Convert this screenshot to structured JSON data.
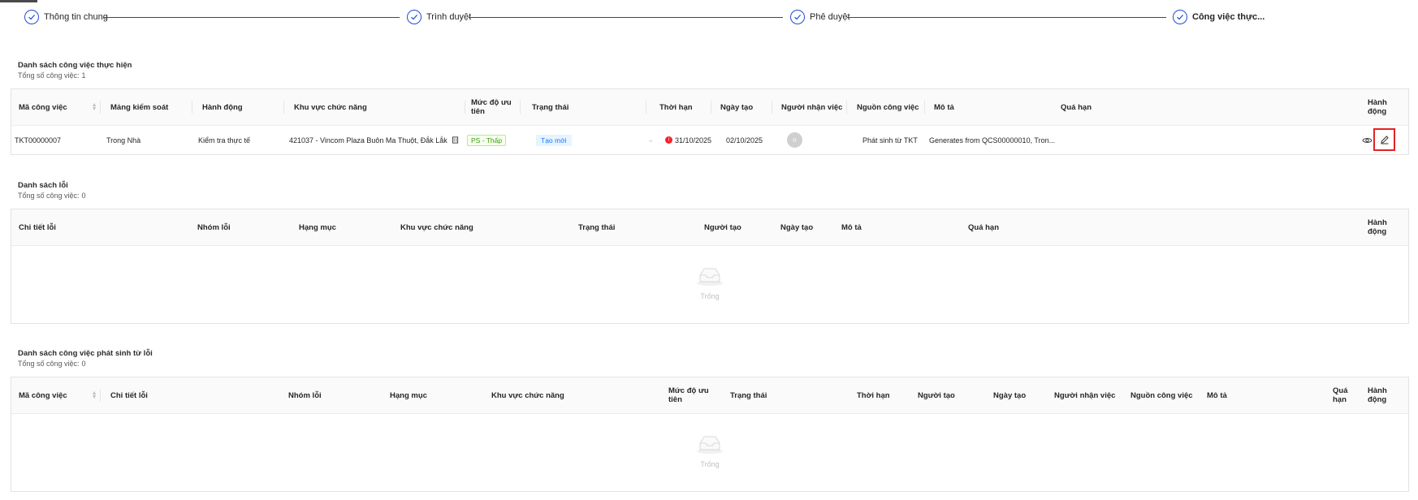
{
  "stepper": {
    "steps": [
      {
        "label": "Thông tin chung",
        "icon": "check-circle-icon"
      },
      {
        "label": "Trình duyệt",
        "icon": "check-circle-icon"
      },
      {
        "label": "Phê duyệt",
        "icon": "check-circle-icon"
      },
      {
        "label": "Công việc thực...",
        "icon": "check-circle-icon"
      }
    ],
    "accent_color": "#1d4ed8"
  },
  "tasks_section": {
    "title": "Danh sách công việc thực hiện",
    "count_label": "Tổng số công việc:",
    "count": "1",
    "columns": [
      "Mã công việc",
      "Mảng kiểm soát",
      "Hành động",
      "Khu vực chức năng",
      "Mức độ ưu tiên",
      "Trạng thái",
      "Thời hạn",
      "Ngày tạo",
      "Người nhận việc",
      "Nguồn công việc",
      "Mô tả",
      "Quá hạn",
      "Hành động"
    ],
    "rows": [
      {
        "code": "TKT00000007",
        "control_area": "Trong Nhà",
        "action": "Kiểm tra thực tế",
        "functional_area": "421037 - Vincom Plaza Buôn Ma Thuột, Đắk Lắk",
        "priority": "PS - Thấp",
        "status": "Tạo mới",
        "deadline": "31/10/2025",
        "created_date": "02/10/2025",
        "assignee_initial": "n",
        "source": "Phát sinh từ TKT",
        "description": "Generates from QCS00000010, Tron...",
        "overdue": ""
      }
    ]
  },
  "errors_section": {
    "title": "Danh sách lỗi",
    "count_label": "Tổng số công việc:",
    "count": "0",
    "columns": [
      "Chi tiết lỗi",
      "Nhóm lỗi",
      "Hạng mục",
      "Khu vực chức năng",
      "Trạng thái",
      "Người tạo",
      "Ngày tạo",
      "Mô tả",
      "Quá hạn",
      "Hành động"
    ],
    "empty_text": "Trống"
  },
  "derived_section": {
    "title": "Danh sách công việc phát sinh từ lỗi",
    "count_label": "Tổng số công việc:",
    "count": "0",
    "columns": [
      "Mã công việc",
      "Chi tiết lỗi",
      "Nhóm lỗi",
      "Hạng mục",
      "Khu vực chức năng",
      "Mức độ ưu tiên",
      "Trạng thái",
      "Thời hạn",
      "Người tạo",
      "Ngày tạo",
      "Người nhận việc",
      "Nguồn công việc",
      "Mô tả",
      "Quá hạn",
      "Hành động"
    ],
    "empty_text": "Trống"
  }
}
